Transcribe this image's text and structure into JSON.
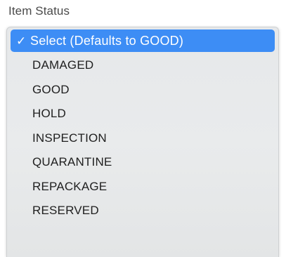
{
  "field": {
    "label": "Item Status"
  },
  "dropdown": {
    "selected_check": "✓",
    "options": [
      {
        "label": "Select (Defaults to GOOD)",
        "selected": true
      },
      {
        "label": "DAMAGED",
        "selected": false
      },
      {
        "label": "GOOD",
        "selected": false
      },
      {
        "label": "HOLD",
        "selected": false
      },
      {
        "label": "INSPECTION",
        "selected": false
      },
      {
        "label": "QUARANTINE",
        "selected": false
      },
      {
        "label": "REPACKAGE",
        "selected": false
      },
      {
        "label": "RESERVED",
        "selected": false
      }
    ]
  },
  "colors": {
    "highlight": "#3d8df5",
    "menu_background": "#e8eaeb",
    "text": "#1f1f1f"
  }
}
